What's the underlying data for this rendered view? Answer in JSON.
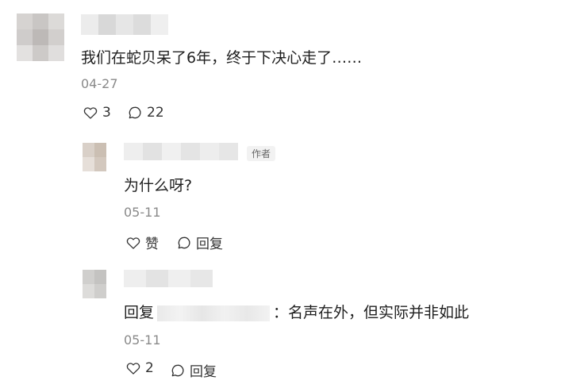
{
  "colors": {
    "text": "#1f1f1f",
    "muted": "#8a8a8a",
    "icon": "#333333",
    "badge_bg": "#f2f2f2"
  },
  "top_comment": {
    "text": "我们在蛇贝呆了6年，终于下决心走了……",
    "date": "04-27",
    "likes": "3",
    "replies": "22"
  },
  "replies": [
    {
      "badge": "作者",
      "text": "为什么呀?",
      "date": "05-11",
      "like_label": "赞",
      "reply_label": "回复"
    },
    {
      "reply_prefix": "回复",
      "text": "：名声在外，但实际并非如此",
      "date": "05-11",
      "likes": "2",
      "reply_label": "回复"
    }
  ],
  "icons": {
    "like": "heart-icon",
    "comment": "speech-bubble-icon"
  }
}
